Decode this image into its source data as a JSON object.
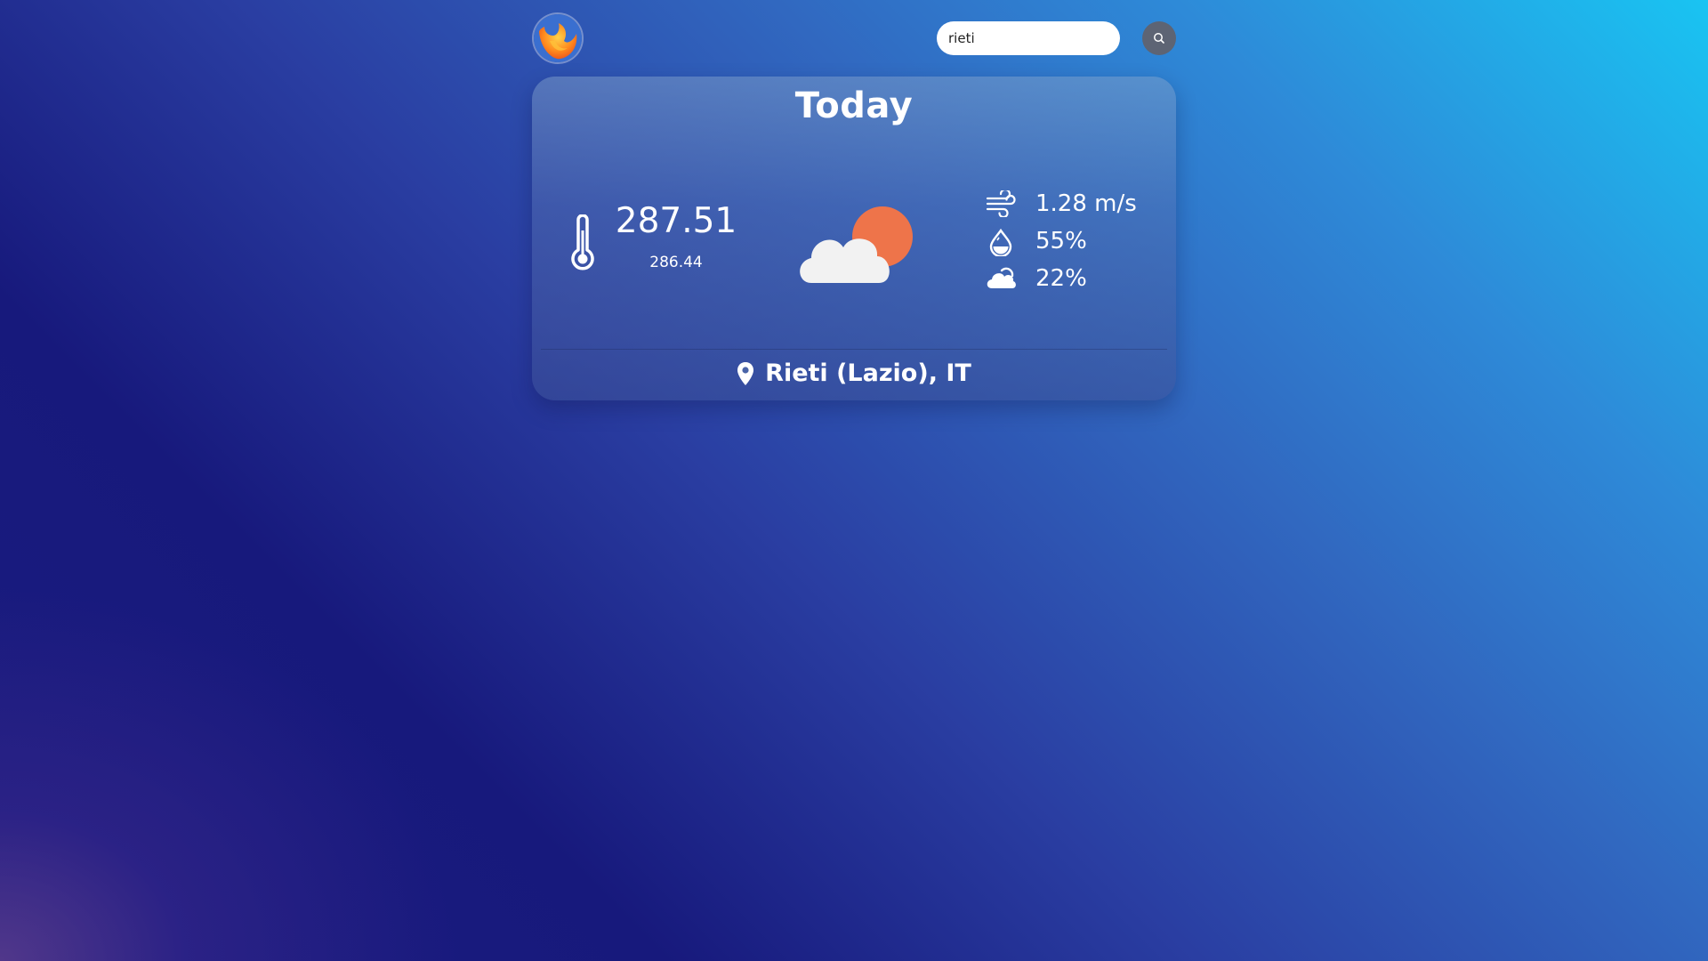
{
  "header": {
    "logo_icon": "firefox-like-logo",
    "search": {
      "value": "rieti",
      "placeholder": ""
    },
    "search_button_icon": "magnifier-icon"
  },
  "card": {
    "title": "Today",
    "temperature": "287.51",
    "feels_like": "286.44",
    "temperature_icon": "thermometer-icon",
    "weather_icon": "partly-cloudy-icon",
    "metrics": [
      {
        "icon": "wind-icon",
        "value": "1.28 m/s"
      },
      {
        "icon": "humidity-drop-icon",
        "value": "55%"
      },
      {
        "icon": "cloud-icon",
        "value": "22%"
      }
    ],
    "location_icon": "map-pin-icon",
    "location": "Rieti (Lazio), IT"
  },
  "colors": {
    "sun": "#ee744a",
    "cloud": "#f2f2f2",
    "search_button": "#5d6474"
  }
}
